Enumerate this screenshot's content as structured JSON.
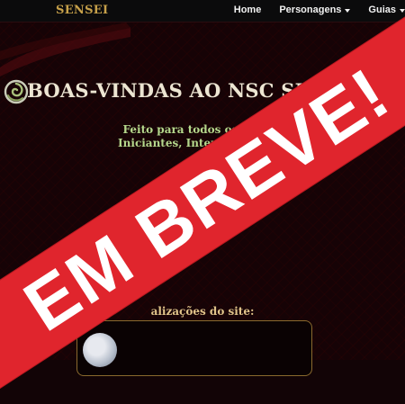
{
  "header": {
    "brand": "SENSEI",
    "nav": [
      {
        "label": "Home"
      },
      {
        "label": "Personagens"
      },
      {
        "label": "Guias"
      }
    ]
  },
  "hero": {
    "title": "BOAS-VINDAS AO NSC SEN",
    "subtitle_line1": "Feito para todos os jogado",
    "subtitle_line2": "Iniciantes, Intermediários e"
  },
  "updates": {
    "heading": "alizações do site:"
  },
  "banner": {
    "text": "EM BREVE!"
  },
  "colors": {
    "accent_gold": "#c7a14a",
    "banner_red": "#e0252d",
    "subtitle_green": "#b5d88c",
    "background": "#160306"
  }
}
